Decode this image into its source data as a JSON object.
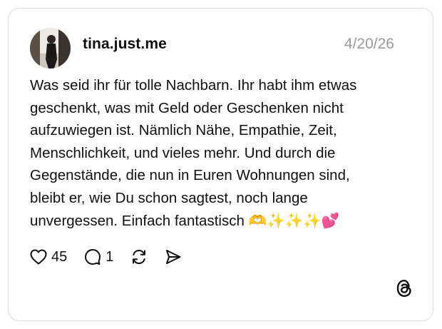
{
  "post": {
    "username": "tina.just.me",
    "date": "4/20/26",
    "text_lines": [
      "Was seid ihr für tolle Nachbarn. Ihr habt ihm etwas",
      "geschenkt,  was mit Geld oder Geschenken nicht",
      "aufzuwiegen ist. Nämlich Nähe, Empathie, Zeit,",
      "Menschlichkeit, und vieles mehr.  Und durch die",
      "Gegenstände,  die nun in Euren Wohnungen sind,",
      "bleibt er, wie Du schon sagtest,  noch lange",
      "unvergessen. Einfach fantastisch 🫶✨✨✨💕"
    ]
  },
  "actions": {
    "like_count": "45",
    "reply_count": "1"
  },
  "icons": {
    "like": "heart-icon",
    "reply": "speech-bubble-icon",
    "repost": "repost-arrows-icon",
    "share": "send-icon",
    "brand": "threads-logo-icon"
  },
  "colors": {
    "text": "#101010",
    "muted": "#9a9a9a",
    "border": "#dcdcdc"
  }
}
